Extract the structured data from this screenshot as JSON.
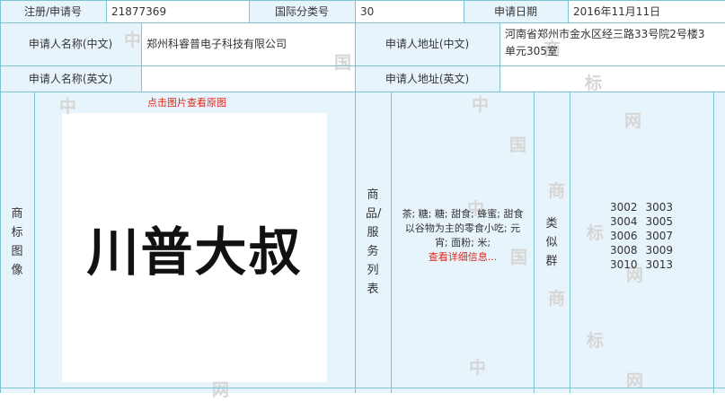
{
  "row1": {
    "reg_label": "注册/申请号",
    "reg_value": "21877369",
    "class_label": "国际分类号",
    "class_value": "30",
    "date_label": "申请日期",
    "date_value": "2016年11月11日"
  },
  "row2": {
    "name_cn_label": "申请人名称(中文)",
    "name_cn_value": "郑州科睿普电子科技有限公司",
    "addr_cn_label": "申请人地址(中文)",
    "addr_cn_value_line1": "河南省郑州市金水区经三路33号院2号楼3",
    "addr_cn_value_line2": "单元305室"
  },
  "row3": {
    "name_en_label": "申请人名称(英文)",
    "name_en_value": "",
    "addr_en_label": "申请人地址(英文)",
    "addr_en_value": ""
  },
  "trademark": {
    "label": "商标图像",
    "click_hint": "点击图片查看原图",
    "mark_text": "川普大叔"
  },
  "goods": {
    "label": "商品/服务列表",
    "items_line1": "茶; 糖; 糖; 甜食; 蜂蜜; 甜食",
    "items_line2": "以谷物为主的零食小吃; 元",
    "items_line3": "宵; 面粉; 米;",
    "more_link": "查看详细信息..."
  },
  "similar": {
    "label": "类似群",
    "groups": [
      "3002",
      "3003",
      "3004",
      "3005",
      "3006",
      "3007",
      "3008",
      "3009",
      "3010",
      "3013"
    ]
  },
  "watermark": {
    "chars": [
      "中",
      "国",
      "商",
      "标",
      "网"
    ]
  },
  "colors": {
    "border": "#7cc4d6",
    "header_bg": "#e8f4fb",
    "link_red": "#e0271a"
  }
}
